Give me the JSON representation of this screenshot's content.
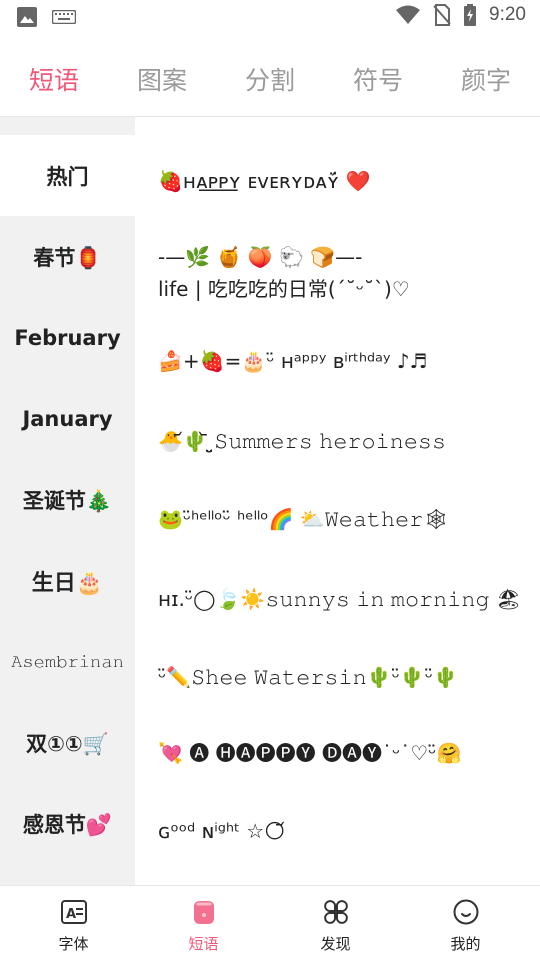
{
  "status_bar": {
    "time": "9:20",
    "icons": [
      "image-icon",
      "keyboard-icon",
      "wifi-icon",
      "no-sim-icon",
      "battery-charging-icon"
    ]
  },
  "tabs": [
    {
      "label": "短语",
      "active": true
    },
    {
      "label": "图案",
      "active": false
    },
    {
      "label": "分割",
      "active": false
    },
    {
      "label": "符号",
      "active": false
    },
    {
      "label": "颜字",
      "active": false
    }
  ],
  "categories": [
    {
      "label": "热门",
      "active": true
    },
    {
      "label": "春节🏮",
      "active": false
    },
    {
      "label": "February",
      "active": false
    },
    {
      "label": "January",
      "active": false
    },
    {
      "label": "圣诞节🎄",
      "active": false
    },
    {
      "label": "生日🎂",
      "active": false
    },
    {
      "label": "𝙰𝚜𝚎𝚖𝚋𝚛𝚒𝚗𝚊𝚗",
      "active": false
    },
    {
      "label": "双①①🛒",
      "active": false
    },
    {
      "label": "感恩节💕",
      "active": false
    }
  ],
  "phrases": [
    "🍓ʜᴀ͟ᴘ͟ᴘ͟ʏ ᴇᴠᴇʀʏᴅᴀʏ̈́ ❤️",
    "-—🌿   🍯   🍑   🐑   🍞—-\nlife | 吃吃吃的日常(ˊ˘ᵕ˘ˋ)♡",
    "🍰+🍓=🎂ᵕ̈ ʜᵃᵖᵖʸ ʙⁱʳᵗʰᵈᵃʸ ♪♬",
    "🐣᷄🌵᷅ ̤̮𝚂𝚞𝚖𝚖𝚎𝚛𝚜 𝚑𝚎𝚛𝚘𝚒𝚗𝚎𝚜𝚜",
    "🐸ᵕ̈ʰᵉˡˡᵒᵕ̈ ʰᵉˡˡᵒ🌈      ⛅𝚆𝚎𝚊𝚝𝚑𝚎𝚛🕸",
    "ʜɪ.ᵕ̈◯🍃☀️𝚜𝚞𝚗𝚗𝚢𝚜 𝚒𝚗 𝚖𝚘𝚛𝚗𝚒𝚗𝚐 🏖",
    "ᵕ̈✏️𝚂𝚑𝚎𝚎 𝚆𝚊𝚝𝚎𝚛𝚜𝚒𝚗🌵ᵕ̈🌵ᵕ̈🌵",
    "💘 🅐 🅗🅐🅟🅟🅨 🅓🅐🅨˙ᵕ˙♡ᵕ̈🤗",
    "ɢᵒᵒᵈ ɴⁱᵍʰᵗ ☆🌕᷄"
  ],
  "bottom_nav": [
    {
      "label": "字体",
      "icon": "font-edit-icon",
      "active": false
    },
    {
      "label": "短语",
      "icon": "chat-bubble-icon",
      "active": true
    },
    {
      "label": "发现",
      "icon": "grid-discover-icon",
      "active": false
    },
    {
      "label": "我的",
      "icon": "smile-profile-icon",
      "active": false
    }
  ],
  "colors": {
    "accent": "#f0587a",
    "accent_light": "#fde0e6",
    "sidebar_bg": "#f1f1f1",
    "inactive_tab": "#9a9a9a"
  }
}
